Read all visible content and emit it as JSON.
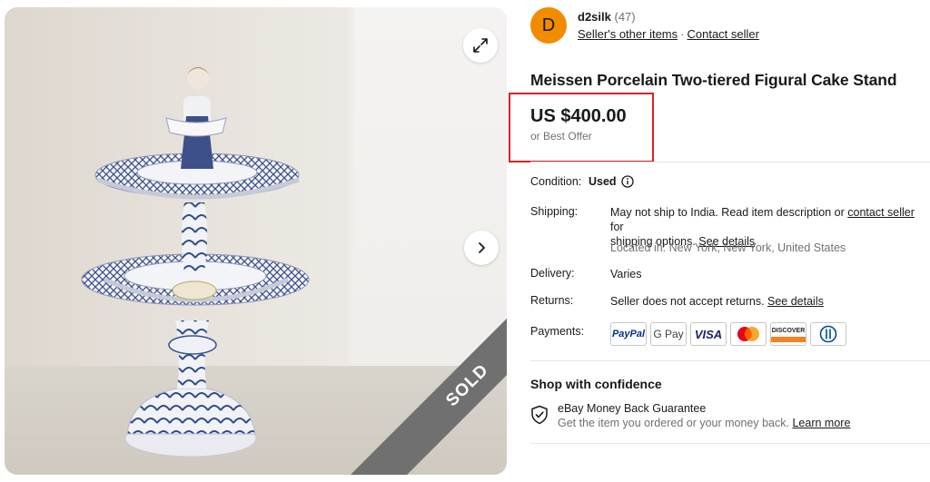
{
  "gallery": {
    "sold_label": "SOLD",
    "expand_icon": "expand-icon",
    "next_icon": "chevron-right-icon"
  },
  "seller": {
    "avatar_letter": "D",
    "avatar_color": "#f18b00",
    "name": "d2silk",
    "feedback_count": "(47)",
    "other_items_label": "Seller's other items",
    "separator": "·",
    "contact_label": "Contact seller"
  },
  "item": {
    "title": "Meissen Porcelain Two-tiered Figural Cake Stand",
    "price": "US $400.00",
    "offer_text": "or Best Offer"
  },
  "condition": {
    "label": "Condition:",
    "value": "Used"
  },
  "shipping": {
    "label": "Shipping:",
    "text_1": "May not ship to India. Read item description or ",
    "contact_link": "contact seller",
    "text_2": " for",
    "text_3": "shipping options. ",
    "details_link": "See details",
    "location": "Located in: New York, New York, United States"
  },
  "delivery": {
    "label": "Delivery:",
    "value": "Varies"
  },
  "returns": {
    "label": "Returns:",
    "value": "Seller does not accept returns. ",
    "details_link": "See details"
  },
  "payments": {
    "label": "Payments:",
    "methods": [
      "PayPal",
      "G Pay",
      "VISA",
      "Mastercard",
      "DISCOVER",
      "Diners Club"
    ]
  },
  "confidence": {
    "title": "Shop with confidence",
    "guarantee_title": "eBay Money Back Guarantee",
    "guarantee_text": "Get the item you ordered or your money back. ",
    "learn_more": "Learn more"
  },
  "colors": {
    "highlight_box": "#e02020",
    "text": "#191919",
    "muted": "#707070",
    "sold_ribbon": "#707070"
  }
}
